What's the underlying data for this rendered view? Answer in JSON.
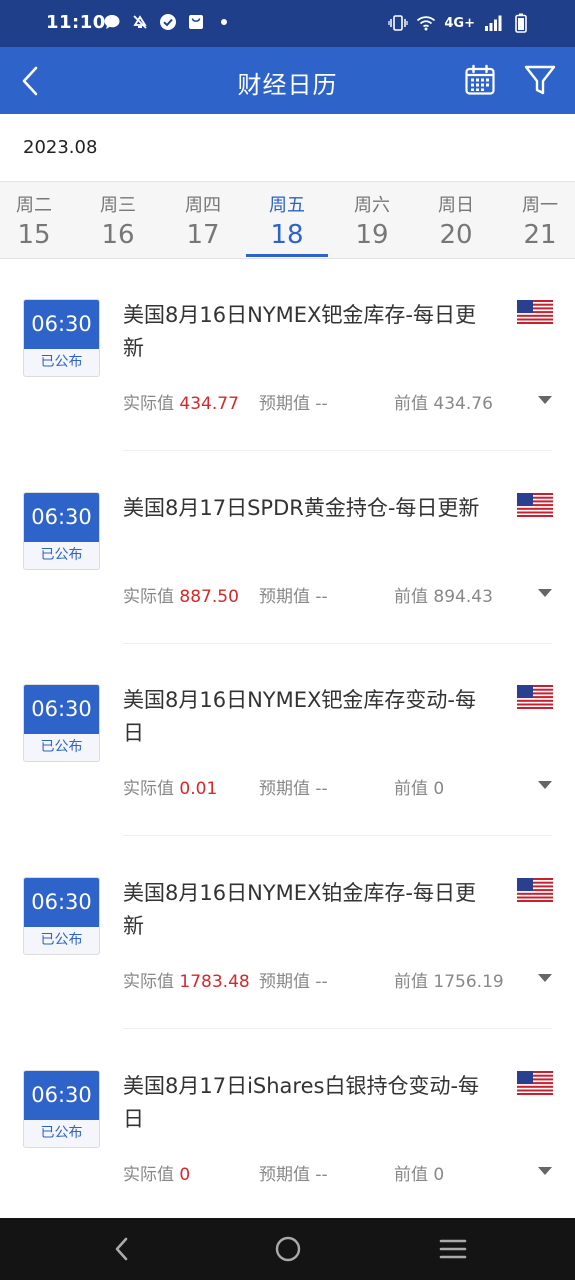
{
  "status_bar": {
    "time": "11:10",
    "network": "4G+"
  },
  "header": {
    "title": "财经日历"
  },
  "month": "2023.08",
  "days": [
    {
      "name": "周二",
      "num": "15",
      "active": false
    },
    {
      "name": "周三",
      "num": "16",
      "active": false
    },
    {
      "name": "周四",
      "num": "17",
      "active": false
    },
    {
      "name": "周五",
      "num": "18",
      "active": true
    },
    {
      "name": "周六",
      "num": "19",
      "active": false
    },
    {
      "name": "周日",
      "num": "20",
      "active": false
    },
    {
      "name": "周一",
      "num": "21",
      "active": false
    }
  ],
  "events": [
    {
      "time": "06:30",
      "status": "已公布",
      "title": "美国8月16日NYMEX钯金库存-每日更新",
      "actual_label": "实际值",
      "actual": "434.77",
      "forecast_label": "预期值",
      "forecast": "--",
      "prev_label": "前值",
      "prev": "434.76"
    },
    {
      "time": "06:30",
      "status": "已公布",
      "title": "美国8月17日SPDR黄金持仓-每日更新",
      "actual_label": "实际值",
      "actual": "887.50",
      "forecast_label": "预期值",
      "forecast": "--",
      "prev_label": "前值",
      "prev": "894.43"
    },
    {
      "time": "06:30",
      "status": "已公布",
      "title": "美国8月16日NYMEX钯金库存变动-每日",
      "actual_label": "实际值",
      "actual": "0.01",
      "forecast_label": "预期值",
      "forecast": "--",
      "prev_label": "前值",
      "prev": "0"
    },
    {
      "time": "06:30",
      "status": "已公布",
      "title": "美国8月16日NYMEX铂金库存-每日更新",
      "actual_label": "实际值",
      "actual": "1783.48",
      "forecast_label": "预期值",
      "forecast": "--",
      "prev_label": "前值",
      "prev": "1756.19"
    },
    {
      "time": "06:30",
      "status": "已公布",
      "title": "美国8月17日iShares白银持仓变动-每日",
      "actual_label": "实际值",
      "actual": "0",
      "forecast_label": "预期值",
      "forecast": "--",
      "prev_label": "前值",
      "prev": "0"
    }
  ],
  "colors": {
    "primary": "#2e63c9",
    "status_bar": "#1f3f8a",
    "accent_red": "#d4282a"
  },
  "icons": {
    "status_left": [
      "chat-bubble-icon",
      "mute-icon",
      "check-circle-icon",
      "shopping-bag-icon",
      "dot-icon"
    ],
    "status_right": [
      "vibrate-icon",
      "wifi-icon",
      "signal-icon",
      "battery-icon"
    ],
    "header": [
      "back-arrow-icon",
      "calendar-icon",
      "filter-icon"
    ],
    "nav": [
      "nav-back-icon",
      "nav-home-icon",
      "nav-menu-icon"
    ]
  }
}
